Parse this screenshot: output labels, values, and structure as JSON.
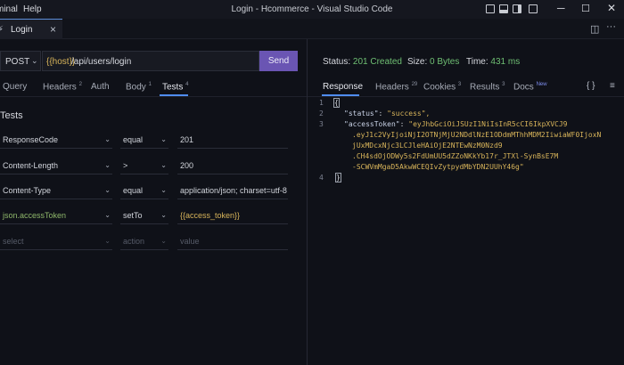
{
  "titlebar": {
    "menu": [
      "minal",
      "Help"
    ],
    "title": "Login - Hcommerce - Visual Studio Code"
  },
  "tabs": {
    "active": {
      "label": "Login",
      "close": "×"
    }
  },
  "request": {
    "method": "POST",
    "url_var": "{{host}}",
    "url_path": "/api/users/login",
    "send_label": "Send",
    "tabs": [
      {
        "label": "Query",
        "count": ""
      },
      {
        "label": "Headers",
        "count": "2"
      },
      {
        "label": "Auth",
        "count": ""
      },
      {
        "label": "Body",
        "count": "1"
      },
      {
        "label": "Tests",
        "count": "4",
        "active": true
      }
    ],
    "section_title": "Tests",
    "tests": [
      {
        "field": "ResponseCode",
        "op": "equal",
        "value": "201"
      },
      {
        "field": "Content-Length",
        "op": ">",
        "value": "200"
      },
      {
        "field": "Content-Type",
        "op": "equal",
        "value": "application/json; charset=utf-8"
      },
      {
        "field": "json.accessToken",
        "op": "setTo",
        "value": "{{access_token}}"
      }
    ],
    "placeholder_row": {
      "field": "select",
      "op": "action",
      "value": "value"
    }
  },
  "response": {
    "status_label": "Status:",
    "status_value": "201 Created",
    "size_label": "Size:",
    "size_value": "0 Bytes",
    "time_label": "Time:",
    "time_value": "431 ms",
    "tabs": [
      {
        "label": "Response",
        "count": "",
        "active": true
      },
      {
        "label": "Headers",
        "count": "29"
      },
      {
        "label": "Cookies",
        "count": "3"
      },
      {
        "label": "Results",
        "count": "3"
      },
      {
        "label": "Docs",
        "count": "New"
      }
    ],
    "line_numbers": [
      "1",
      "2",
      "3",
      "4"
    ],
    "body": {
      "open": "{",
      "status_key": "\"status\"",
      "status_val": "\"success\",",
      "token_key": "\"accessToken\"",
      "token_lines": [
        "\"eyJhbGciOiJSUzI1NiIsInR5cCI6IkpXVCJ9",
        ".eyJ1c2VyIjoiNjI2OTNjMjU2NDdlNzE1ODdmMThhMDM2IiwiaWF0IjoxN",
        "jUxMDcxNjc3LCJleHAiOjE2NTEwNzM0Nzd9",
        ".CH4sdOjODWy5s2FdUmUU5dZZoNKkYb17r_JTXl-SynBsE7M",
        "-SCWVmMgaD5AkwWCEQIvZytpydMbYDN2UUhY46g\""
      ],
      "close": "}"
    }
  },
  "colors": {
    "accent": "#6a55b3",
    "status_ok": "#6fbf73",
    "string": "#d8b45a",
    "var_green": "#8fb86b"
  }
}
